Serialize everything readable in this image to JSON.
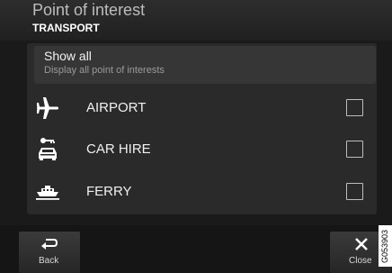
{
  "header": {
    "title": "Point of interest",
    "subtitle": "TRANSPORT"
  },
  "show_all": {
    "title": "Show all",
    "description": "Display all point of interests"
  },
  "items": [
    {
      "label": "AIRPORT",
      "icon": "airplane-icon",
      "checked": false
    },
    {
      "label": "CAR HIRE",
      "icon": "car-hire-icon",
      "checked": false
    },
    {
      "label": "FERRY",
      "icon": "ferry-icon",
      "checked": false
    }
  ],
  "footer": {
    "back_label": "Back",
    "close_label": "Close"
  },
  "figure_code": "G053903",
  "colors": {
    "background": "#1a1a1a",
    "panel": "#2a2a2a",
    "text": "#ffffff"
  }
}
